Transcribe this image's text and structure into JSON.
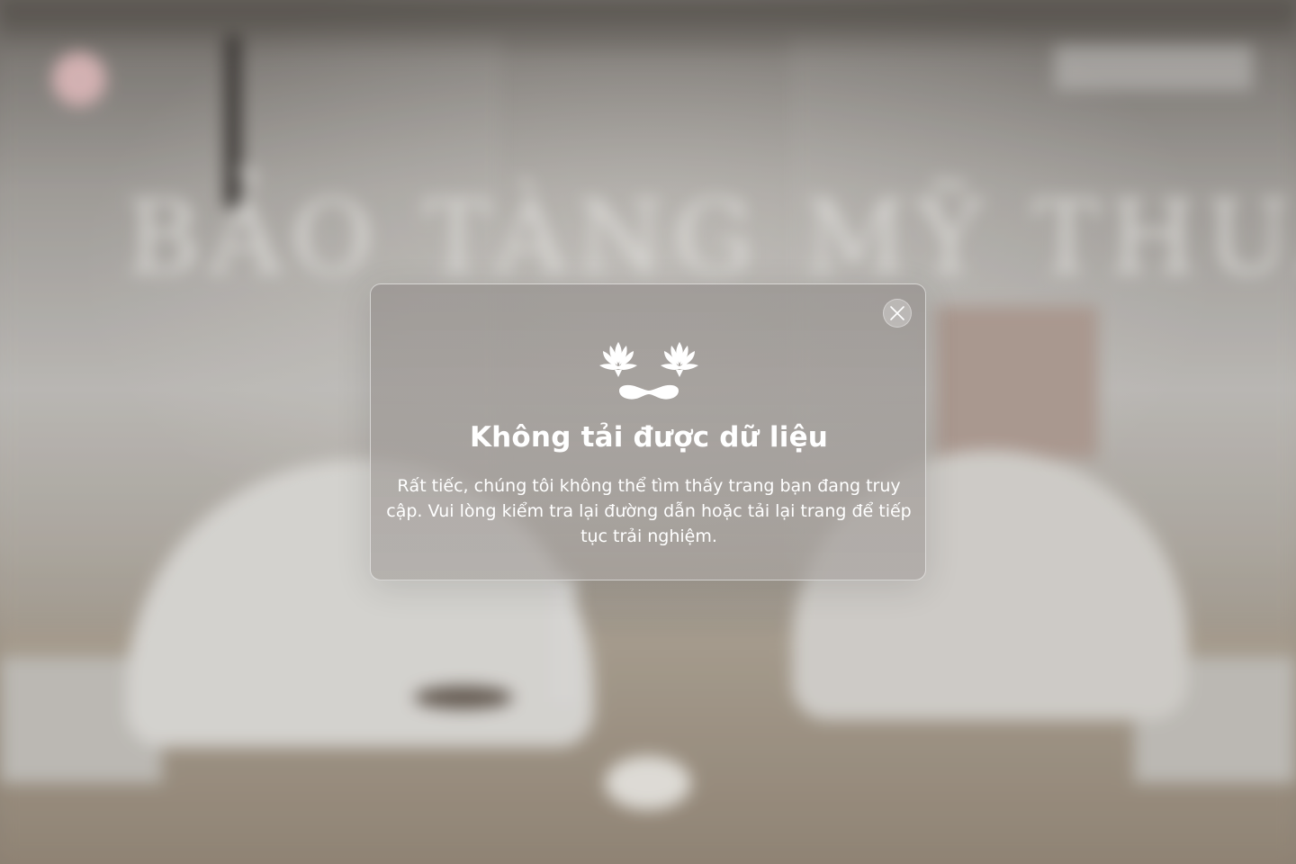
{
  "background": {
    "heading": "BẢO TÀNG MỸ THUẬT",
    "subheading": "",
    "left_caption": "",
    "right_caption": ""
  },
  "modal": {
    "icon": "lotus-smile-icon",
    "close_icon": "close-icon",
    "title": "Không tải được dữ liệu",
    "message": "Rất tiếc, chúng tôi không thể tìm thấy trang bạn đang truy cập. Vui lòng kiểm tra lại đường dẫn hoặc tải lại trang để tiếp tục trải nghiệm."
  },
  "colors": {
    "modal_text": "#ffffff",
    "modal_border": "#ffffff",
    "logo_accent": "#e8c2c4"
  }
}
